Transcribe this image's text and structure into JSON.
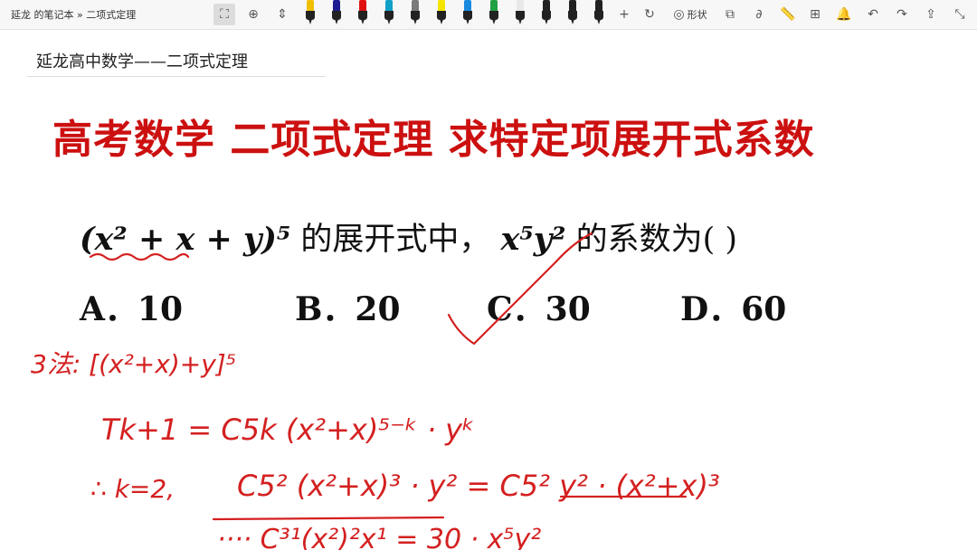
{
  "toolbar": {
    "breadcrumb": "延龙 的笔记本 » 二项式定理",
    "shape_label": "形状",
    "pen_colors": [
      "#f0c000",
      "#1d1d8f",
      "#e01010",
      "#10a0c8",
      "#7a7a7a",
      "#f5e400",
      "#1a8ae0",
      "#20a040",
      "#e8e8e8",
      "#222222",
      "#222222",
      "#222222"
    ]
  },
  "page": {
    "title": "延龙高中数学——二项式定理",
    "headline": "高考数学 二项式定理 求特定项展开式系数",
    "question": {
      "part1": "(x² + x + y)⁵",
      "part2": "的展开式中，",
      "part3": "x⁵y²",
      "part4": "的系数为(        )"
    },
    "options": [
      {
        "label": "A．10"
      },
      {
        "label": "B．20"
      },
      {
        "label": "C．30"
      },
      {
        "label": "D．60"
      }
    ]
  },
  "ink": {
    "line1": "3法: [(x²+x)+y]⁵",
    "line2": "Tk+1 = C5k (x²+x)⁵⁻ᵏ · yᵏ",
    "line3a": "∴ k=2,",
    "line3b": "C5² (x²+x)³ · y² = C5² y² · (x²+x)³",
    "line4": "···· C³¹(x²)²x¹ = 30 · x⁵y²",
    "color": "#d42020"
  }
}
